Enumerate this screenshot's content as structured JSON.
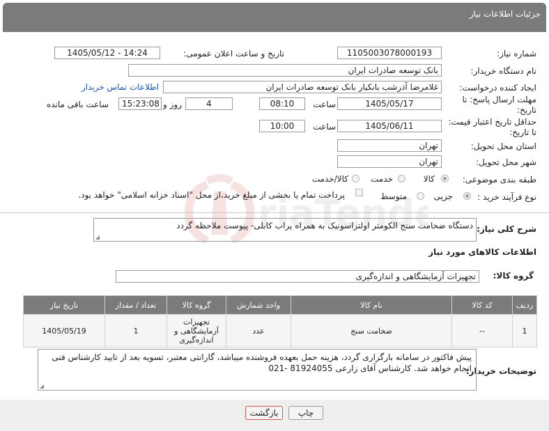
{
  "header": {
    "title": "جزئیات اطلاعات نیاز"
  },
  "form": {
    "need_number_label": "شماره نیاز:",
    "need_number": "1105003078000193",
    "announce_label": "تاریخ و ساعت اعلان عمومی:",
    "announce_value": "1405/05/12 - 14:24",
    "buyer_org_label": "نام دستگاه خریدار:",
    "buyer_org": "بانک توسعه صادرات ایران",
    "requester_label": "ایجاد کننده درخواست:",
    "requester": "غلامرضا آذرشب بانکیار بانک توسعه صادرات ایران",
    "contact_link": "اطلاعات تماس خریدار",
    "deadline_label_1": "مهلت ارسال پاسخ: تا",
    "deadline_label_2": "تاریخ:",
    "deadline_date": "1405/05/17",
    "time_label": "ساعت",
    "deadline_time": "08:10",
    "days_value": "4",
    "days_label": "روز و",
    "remaining_time": "15:23:08",
    "remaining_label": "ساعت باقی مانده",
    "price_validity_label_1": "حداقل تاریخ اعتبار قیمت:",
    "price_validity_label_2": "تا تاریخ:",
    "price_validity_date": "1405/06/11",
    "price_validity_time": "10:00",
    "province_label": "استان محل تحویل:",
    "province": "تهران",
    "city_label": "شهر محل تحویل:",
    "city": "تهران",
    "category_label": "طبقه بندی موضوعی:",
    "category_options": [
      "کالا",
      "خدمت",
      "کالا/خدمت"
    ],
    "process_label": "نوع فرآیند خرید :",
    "process_options": [
      "جزیی",
      "متوسط"
    ],
    "payment_note": "پرداخت تمام یا بخشی از مبلغ خرید،از محل \"اسناد خزانه اسلامی\" خواهد بود."
  },
  "summary": {
    "label": "شرح کلی نیاز:",
    "text": "دستگاه ضخامت سنج الکومتر اولتراسونیک به همراه پراب کابلی- پیوست ملاحظه گردد"
  },
  "goods_info_title": "اطلاعات کالاهای مورد نیاز",
  "goods_group": {
    "label": "گروه کالا:",
    "value": "تجهیزات آزمایشگاهی و اندازه‌گیری"
  },
  "table": {
    "headers": [
      "ردیف",
      "کد کالا",
      "نام کالا",
      "واحد شمارش",
      "گروه کالا",
      "تعداد / مقدار",
      "تاریخ نیاز"
    ],
    "row": {
      "index": "1",
      "code": "--",
      "name": "ضخامت سنج",
      "unit": "عدد",
      "group": "تجهیزات آزمایشگاهی و اندازه‌گیری",
      "qty": "1",
      "date": "1405/05/19"
    }
  },
  "buyer_notes": {
    "label": "توضیحات خریدار:",
    "text": "پیش فاکتور در سامانه بارگزاری گردد، هزینه حمل بعهده فروشنده میباشد، گارانتی معتبر، تسویه بعد از تایید کارشناس فنی انجام خواهد شد. کارشناس آقای زارعی 81924055 -021"
  },
  "buttons": {
    "print": "چاپ",
    "back": "بازگشت"
  },
  "watermark": {
    "text": "AriaTender.net"
  },
  "colors": {
    "header_bg": "#7a7b7d",
    "link": "#1a56b8",
    "back_border": "#d9534f"
  }
}
